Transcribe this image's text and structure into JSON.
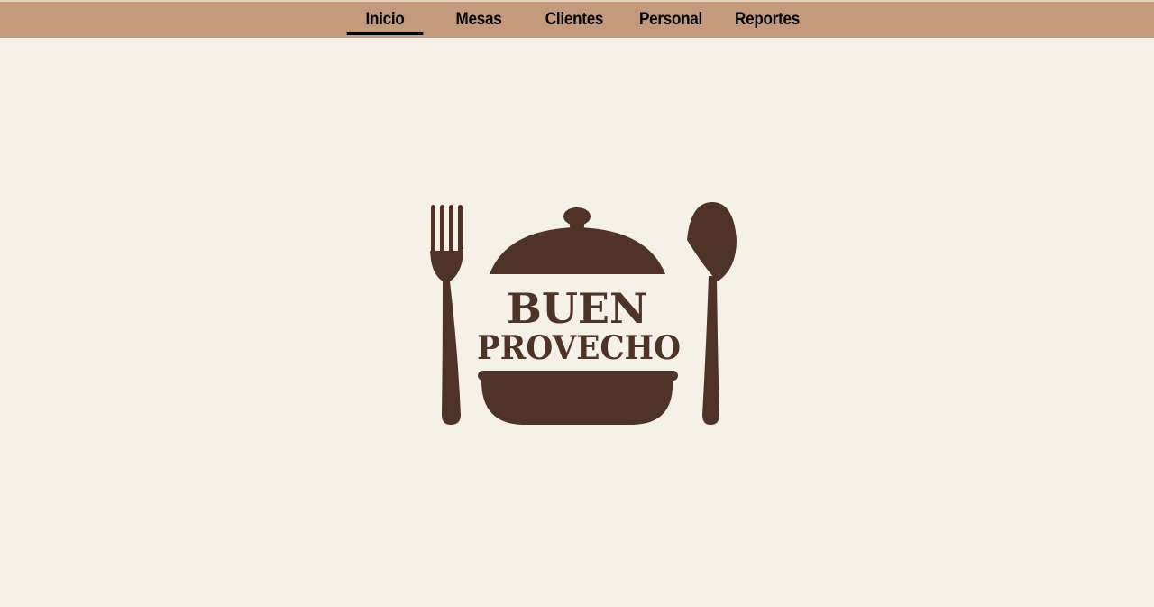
{
  "nav": {
    "items": [
      {
        "label": "Inicio",
        "active": true
      },
      {
        "label": "Mesas",
        "active": false
      },
      {
        "label": "Clientes",
        "active": false
      },
      {
        "label": "Personal",
        "active": false
      },
      {
        "label": "Reportes",
        "active": false
      }
    ]
  },
  "logo": {
    "line1": "BUEN",
    "line2": "PROVECHO",
    "color": "#4e3326"
  },
  "colors": {
    "topbar": "#c49a7c",
    "background": "#f6f1e7",
    "nav_text": "#000000"
  }
}
